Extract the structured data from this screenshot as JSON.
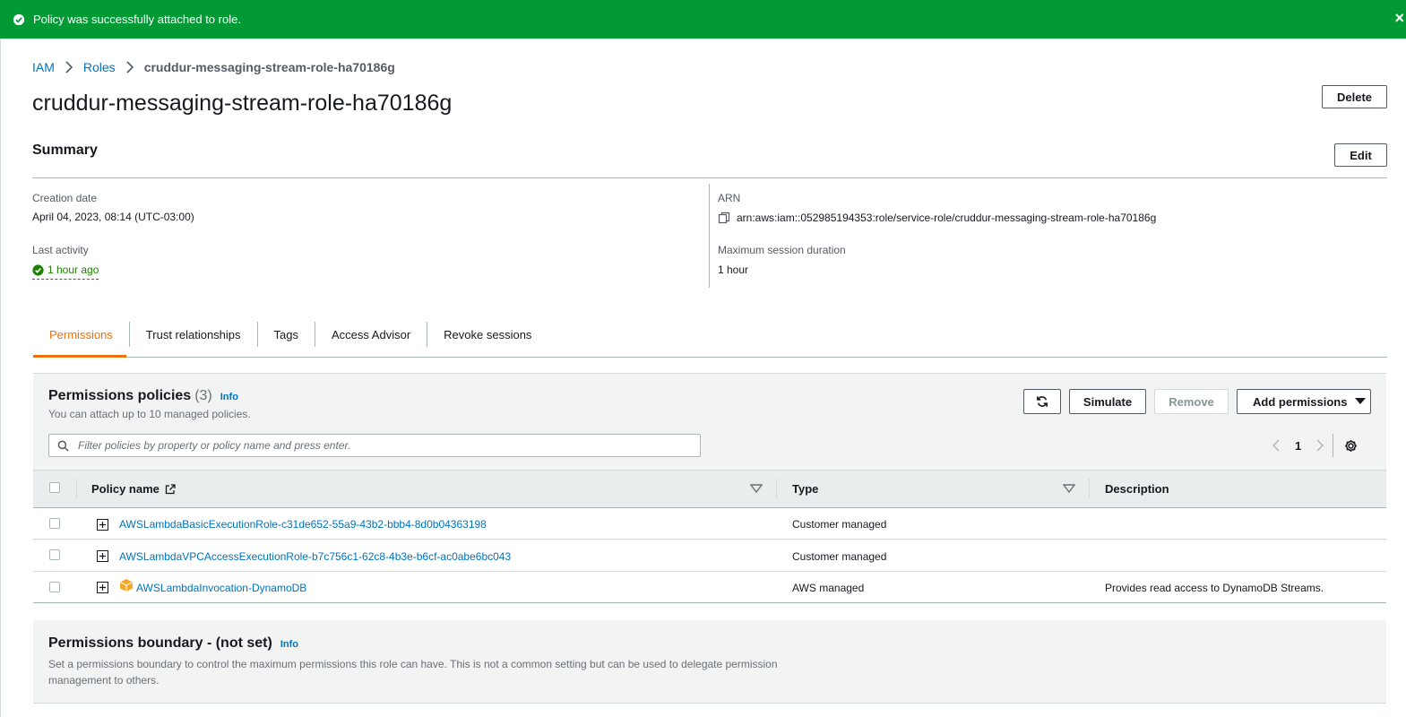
{
  "flash": {
    "message": "Policy was successfully attached to role.",
    "close_label": "×",
    "color": "#029a34"
  },
  "breadcrumb": {
    "items": [
      "IAM",
      "Roles"
    ],
    "current": "cruddur-messaging-stream-role-ha70186g"
  },
  "page": {
    "title": "cruddur-messaging-stream-role-ha70186g",
    "delete_label": "Delete"
  },
  "summary": {
    "heading": "Summary",
    "edit_label": "Edit",
    "creation_date_label": "Creation date",
    "creation_date": "April 04, 2023, 08:14 (UTC-03:00)",
    "last_activity_label": "Last activity",
    "last_activity": "1 hour ago",
    "arn_label": "ARN",
    "arn": "arn:aws:iam::052985194353:role/service-role/cruddur-messaging-stream-role-ha70186g",
    "max_session_label": "Maximum session duration",
    "max_session": "1 hour"
  },
  "tabs": [
    "Permissions",
    "Trust relationships",
    "Tags",
    "Access Advisor",
    "Revoke sessions"
  ],
  "active_tab": "Permissions",
  "permissions": {
    "heading": "Permissions policies",
    "count": "(3)",
    "info": "Info",
    "description": "You can attach up to 10 managed policies.",
    "simulate_label": "Simulate",
    "remove_label": "Remove",
    "add_label": "Add permissions",
    "search_placeholder": "Filter policies by property or policy name and press enter.",
    "page": "1",
    "columns": [
      "Policy name",
      "Type",
      "Description"
    ],
    "rows": [
      {
        "name": "AWSLambdaBasicExecutionRole-c31de652-55a9-43b2-bbb4-8d0b04363198",
        "type": "Customer managed",
        "description": ""
      },
      {
        "name": "AWSLambdaVPCAccessExecutionRole-b7c756c1-62c8-4b3e-b6cf-ac0abe6bc043",
        "type": "Customer managed",
        "description": ""
      },
      {
        "name": "AWSLambdaInvocation-DynamoDB",
        "type": "AWS managed",
        "description": "Provides read access to DynamoDB Streams."
      }
    ]
  },
  "boundary": {
    "heading": "Permissions boundary - (not set)",
    "info": "Info",
    "description": "Set a permissions boundary to control the maximum permissions this role can have. This is not a common setting but can be used to delegate permission management to others."
  },
  "colors": {
    "link": "#0073bb",
    "active_tab": "#ec7211",
    "success": "#1d8102",
    "aws_managed_icon": "#f5a623"
  }
}
